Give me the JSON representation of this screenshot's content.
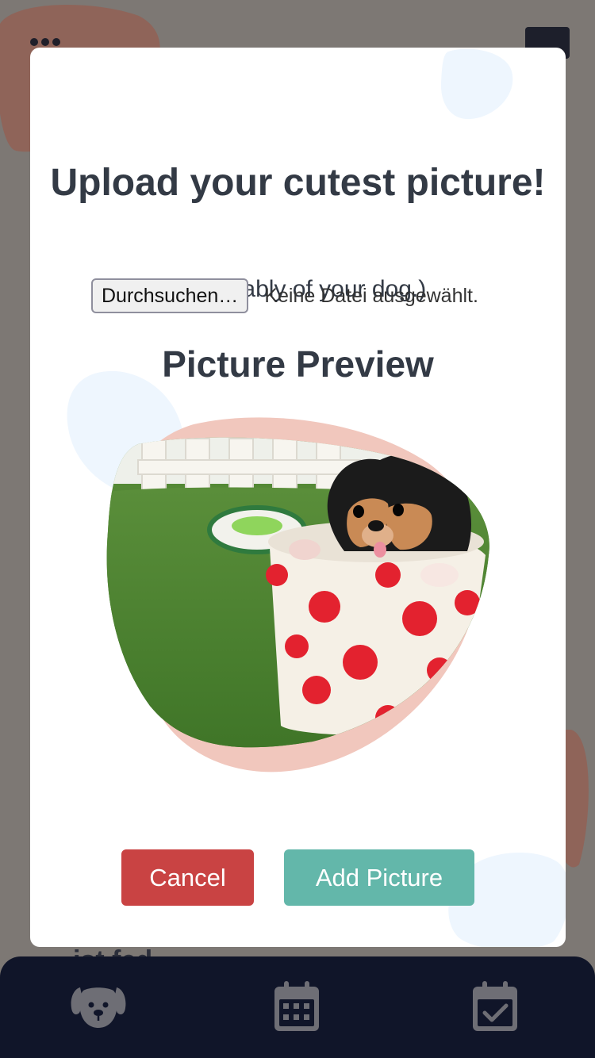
{
  "colors": {
    "overlay": "#7d7874",
    "modal": "#ffffff",
    "heading_text": "#333a45",
    "cancel": "#c94343",
    "add_picture": "#63b7aa",
    "nav_bar": "#101529",
    "nav_icon": "#6e6e75",
    "blob_pink": "#f1c7bd",
    "blob_blue": "#eef6fe"
  },
  "modal": {
    "title": "Upload your cutest picture!",
    "subtitle": "(Preferably of your dog.)",
    "file_input": {
      "button_label": "Durchsuchen…",
      "status": "Keine Datei ausgewählt."
    },
    "preview_heading": "Picture Preview",
    "preview_image": "puppy-in-polka-dot-cup",
    "buttons": {
      "cancel": "Cancel",
      "add": "Add Picture"
    }
  },
  "background": {
    "menu_icon": "more-horizontal-icon",
    "image_icon": "image-icon",
    "partial_text": "ist fed"
  },
  "bottom_nav": {
    "items": [
      {
        "icon": "dog-icon"
      },
      {
        "icon": "calendar-icon"
      },
      {
        "icon": "calendar-check-icon"
      }
    ]
  }
}
